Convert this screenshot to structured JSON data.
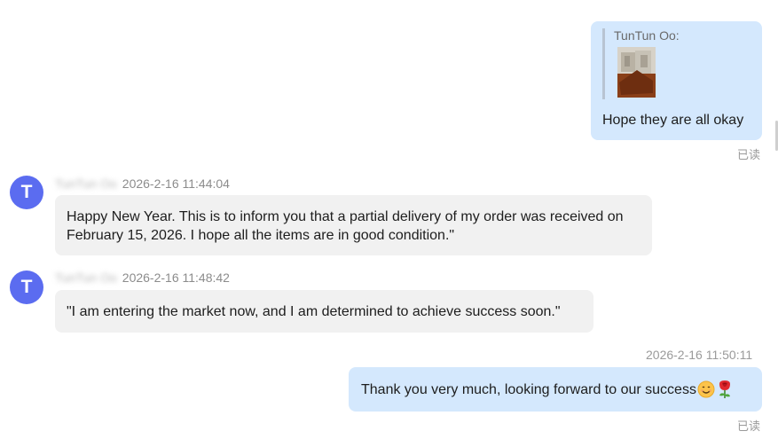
{
  "messages": [
    {
      "direction": "out",
      "quote": {
        "author": "TunTun Oo:",
        "image": "photo-thumbnail"
      },
      "text": "Hope they are all okay",
      "status": "已读"
    },
    {
      "direction": "in",
      "sender": "TunTun Oo",
      "time": "2026-2-16 11:44:04",
      "avatar_letter": "T",
      "text_line1": "Happy New Year. This is to inform you that a partial delivery of my order was received on",
      "text_line2": "February 15, 2026. I hope all the items are in good condition.\""
    },
    {
      "direction": "in",
      "sender": "TunTun Oo",
      "time": "2026-2-16 11:48:42",
      "avatar_letter": "T",
      "text": "\"I am entering the market now, and I am determined to achieve success soon.\""
    },
    {
      "direction": "out",
      "time": "2026-2-16 11:50:11",
      "text": "Thank you very much, looking forward to our success",
      "emojis": [
        "smiling-face-emoji",
        "rose-emoji"
      ],
      "status": "已读"
    }
  ],
  "colors": {
    "outgoing_bubble": "#d4e8fd",
    "incoming_bubble": "#f1f1f1",
    "avatar": "#5b6cf0",
    "meta_text": "#8c8c8c"
  }
}
